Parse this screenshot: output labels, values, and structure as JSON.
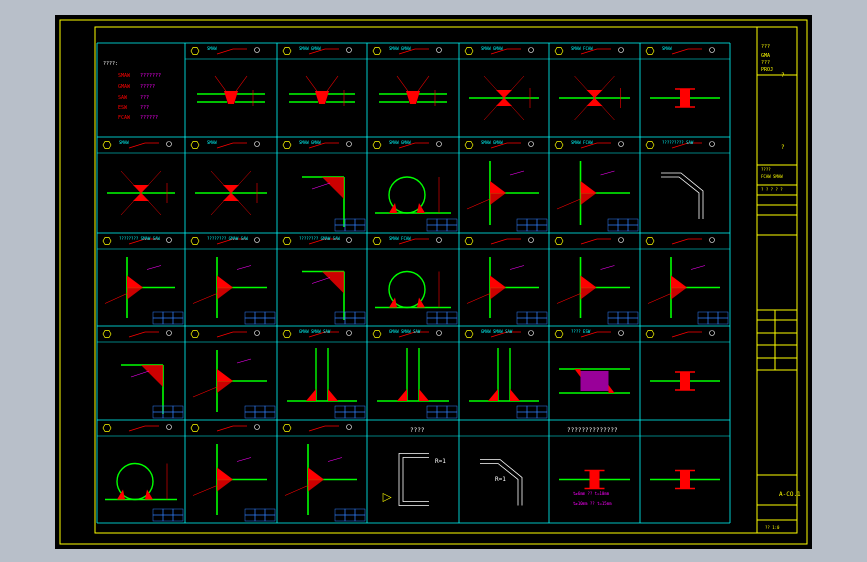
{
  "legend": {
    "heading": "????:",
    "items": [
      {
        "code": "SMAW",
        "desc": "???????"
      },
      {
        "code": "GMAW",
        "desc": "?????"
      },
      {
        "code": "SAW",
        "desc": "???"
      },
      {
        "code": "ESW",
        "desc": "???"
      },
      {
        "code": "FCAW",
        "desc": "??????"
      }
    ]
  },
  "row1_labels": [
    "SMAW",
    "SMAW GMAW",
    "SMAW GMAW",
    "SMAW GMAW",
    "SMAW FCAW",
    "SMAW"
  ],
  "row2_labels": [
    "SMAW",
    "SMAW",
    "SMAW GMAW",
    "SMAW GMAW",
    "SMAW GMAW",
    "SMAW FCAW",
    "????????? SAW"
  ],
  "row3_labels": [
    "???????? SMAW SAW",
    "???????? GMAW SAW",
    "???????? GMAW SAW",
    "SMAW FCAW",
    "",
    "",
    ""
  ],
  "row4_labels": [
    "",
    "",
    "GMAW SMAW SAW",
    "GMAW SMAW SAW",
    "GMAW SMAW SAW",
    "???? ESW",
    ""
  ],
  "row5_headers": [
    "????",
    "??????????????"
  ],
  "r_labels": [
    "R=1",
    "R=1"
  ],
  "row5_notes": [
    "t≥6mm ?? t=10mm",
    "t≥10mm ?? t=15mm"
  ],
  "title_block": {
    "field1": "???",
    "field2": "GMA",
    "field3": "???",
    "field4": "PROJ",
    "mark1": "?",
    "mark2": "?",
    "field5": "????",
    "field6": "FCAW SMAW",
    "revision": "? ? ? ? ?",
    "drawing_no": "A-CO.1",
    "scale": "?? 1:0"
  },
  "colors": {
    "frame": "#ffff00",
    "grid": "#00ffff",
    "weld": "#ff0000",
    "plate": "#00ff00",
    "text": "#ff00ff",
    "background": "#000000"
  }
}
